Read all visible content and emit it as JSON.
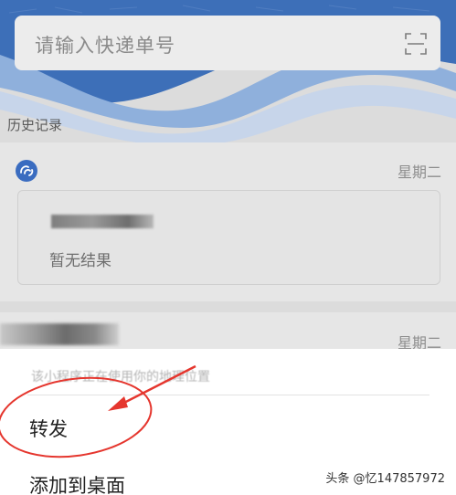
{
  "search": {
    "placeholder": "请输入快递单号",
    "scan_icon": "scan-icon"
  },
  "history": {
    "title": "历史记录",
    "items": [
      {
        "weekday": "星期二",
        "status": "暂无结果"
      },
      {
        "weekday": "星期二"
      }
    ]
  },
  "action_sheet": {
    "location_notice": "该小程序正在使用你的地理位置",
    "items": [
      {
        "label": "转发"
      },
      {
        "label": "添加到桌面"
      }
    ]
  },
  "watermark": "头条 @忆147857972",
  "colors": {
    "wave_light": "#c7d5ea",
    "wave_mid": "#8fb0dc",
    "wave_dark": "#3d6fb8",
    "annotation_red": "#e5362e"
  }
}
